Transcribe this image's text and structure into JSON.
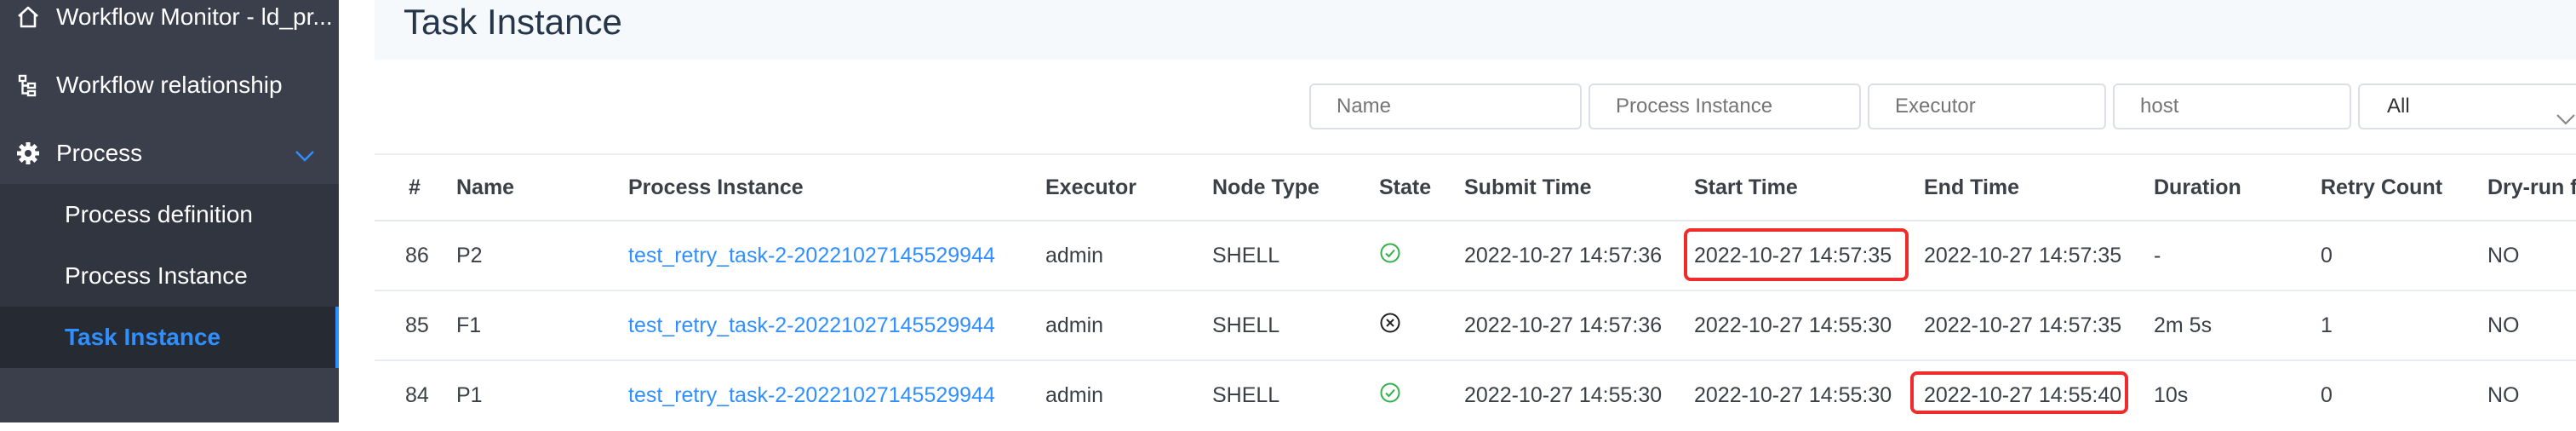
{
  "sidebar": {
    "items": [
      {
        "label": "Workflow Monitor - ld_pr...",
        "icon": "home-icon"
      },
      {
        "label": "Workflow relationship",
        "icon": "tree-icon"
      },
      {
        "label": "Process",
        "icon": "gear-icon",
        "expanded": true
      }
    ],
    "subitems": [
      {
        "label": "Process definition"
      },
      {
        "label": "Process Instance"
      },
      {
        "label": "Task Instance",
        "active": true
      }
    ]
  },
  "page": {
    "title": "Task Instance"
  },
  "filters": {
    "name_placeholder": "Name",
    "process_instance_placeholder": "Process Instance",
    "executor_placeholder": "Executor",
    "host_placeholder": "host",
    "state_value": "All"
  },
  "table": {
    "columns": [
      "#",
      "Name",
      "Process Instance",
      "Executor",
      "Node Type",
      "State",
      "Submit Time",
      "Start Time",
      "End Time",
      "Duration",
      "Retry Count",
      "Dry-run f"
    ],
    "rows": [
      {
        "id": "86",
        "name": "P2",
        "process_instance": "test_retry_task-2-20221027145529944",
        "executor": "admin",
        "node_type": "SHELL",
        "state": "success",
        "submit_time": "2022-10-27 14:57:36",
        "start_time": "2022-10-27 14:57:35",
        "end_time": "2022-10-27 14:57:35",
        "duration": "-",
        "retry_count": "0",
        "dry_run": "NO"
      },
      {
        "id": "85",
        "name": "F1",
        "process_instance": "test_retry_task-2-20221027145529944",
        "executor": "admin",
        "node_type": "SHELL",
        "state": "failed",
        "submit_time": "2022-10-27 14:57:36",
        "start_time": "2022-10-27 14:55:30",
        "end_time": "2022-10-27 14:57:35",
        "duration": "2m 5s",
        "retry_count": "1",
        "dry_run": "NO"
      },
      {
        "id": "84",
        "name": "P1",
        "process_instance": "test_retry_task-2-20221027145529944",
        "executor": "admin",
        "node_type": "SHELL",
        "state": "success",
        "submit_time": "2022-10-27 14:55:30",
        "start_time": "2022-10-27 14:55:30",
        "end_time": "2022-10-27 14:55:40",
        "duration": "10s",
        "retry_count": "0",
        "dry_run": "NO"
      }
    ]
  },
  "colors": {
    "sidebar_bg": "#3a3f4b",
    "active": "#2f8fff",
    "success": "#33b04a",
    "highlight": "#ef2b2b"
  }
}
